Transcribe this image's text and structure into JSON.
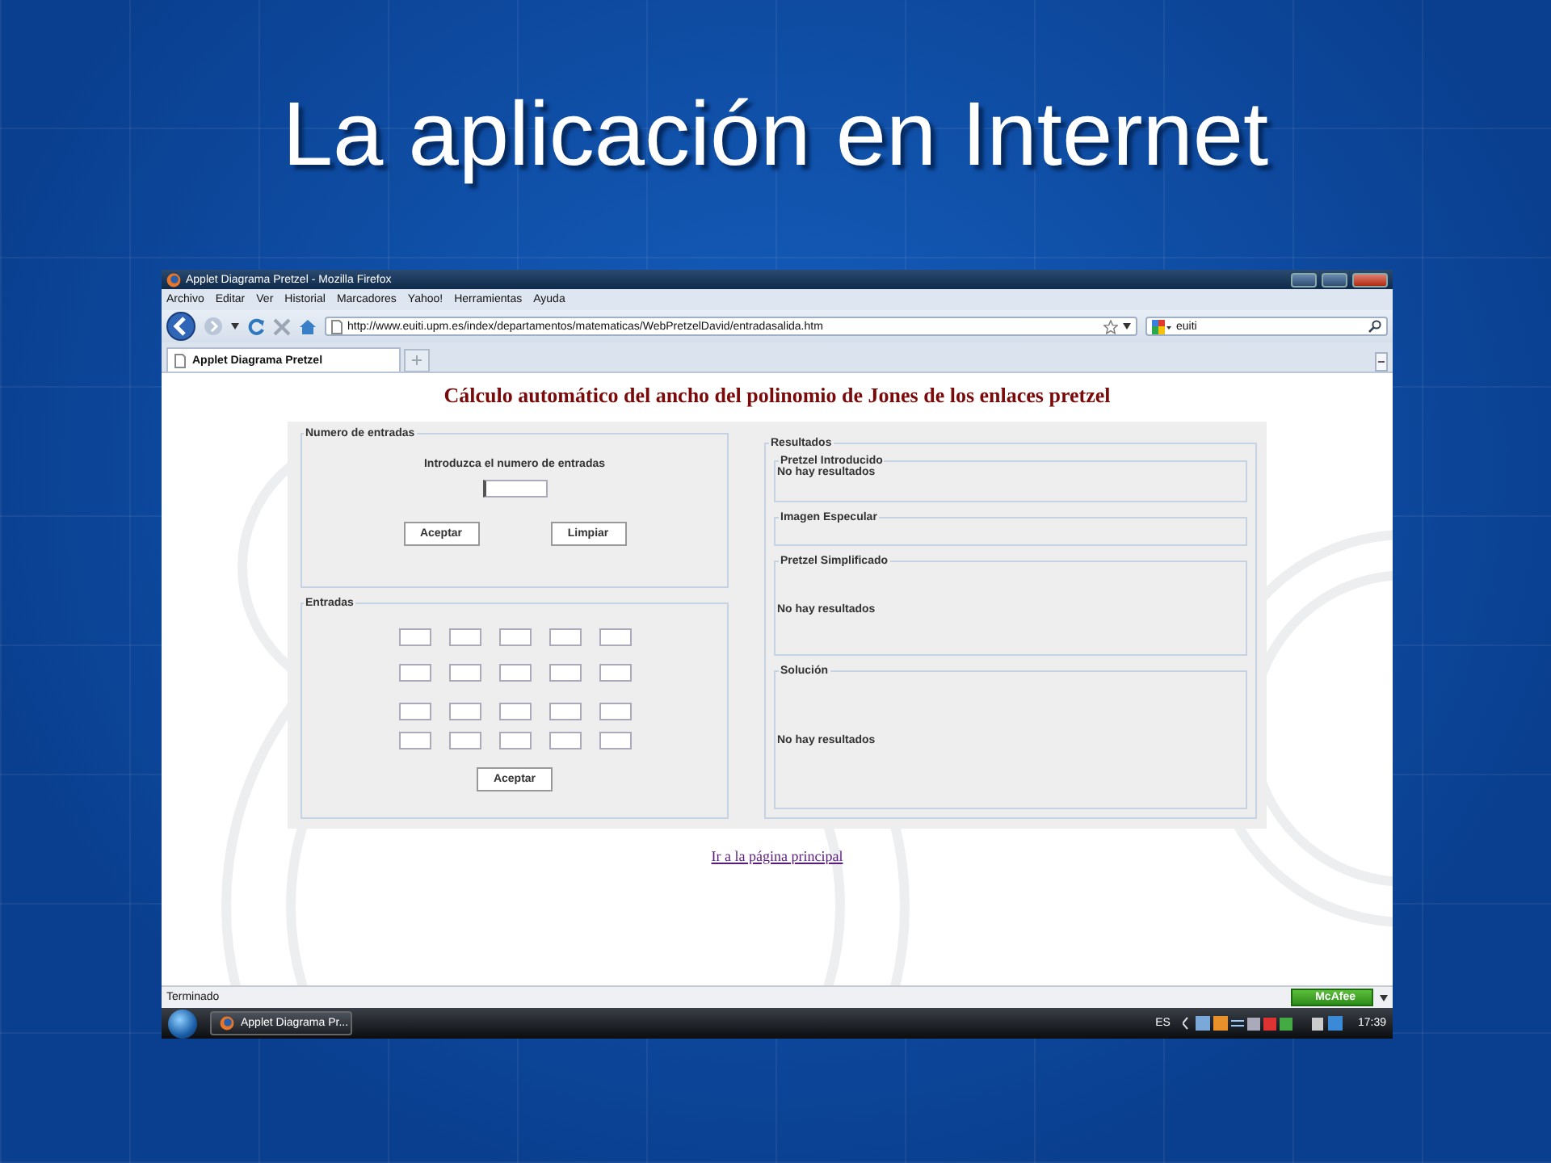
{
  "slide": {
    "title": "La aplicación en Internet"
  },
  "window": {
    "title": "Applet Diagrama Pretzel - Mozilla Firefox"
  },
  "menu": [
    "Archivo",
    "Editar",
    "Ver",
    "Historial",
    "Marcadores",
    "Yahoo!",
    "Herramientas",
    "Ayuda"
  ],
  "address_bar": {
    "value": "http://www.euiti.upm.es/index/departamentos/matematicas/WebPretzelDavid/entradasalida.htm"
  },
  "search": {
    "value": "euiti"
  },
  "tabs": [
    {
      "label": "Applet Diagrama Pretzel",
      "selected": true
    }
  ],
  "page": {
    "heading": "Cálculo automático del ancho del polinomio de Jones de los enlaces pretzel",
    "input_panel": {
      "legend": "Numero de entradas",
      "prompt": "Introduzca el numero de entradas",
      "buttons": [
        "Aceptar",
        "Limpiar"
      ]
    },
    "entries_panel": {
      "legend": "Entradas",
      "buttons": [
        "Aceptar"
      ]
    },
    "results": {
      "legend": "Resultados",
      "sections": [
        {
          "legend": "Pretzel Introducido",
          "text": "No hay resultados"
        },
        {
          "legend": "Imagen Especular"
        },
        {
          "legend": "Pretzel Simplificado",
          "text": "No hay resultados"
        },
        {
          "legend": "Solución",
          "text": "No hay resultados"
        }
      ]
    },
    "link": "Ir a la página principal"
  },
  "status_bar": {
    "text": "Terminado",
    "addon": "McAfee"
  },
  "taskbar": {
    "items": [
      "Applet Diagrama Pr..."
    ],
    "language": "ES",
    "time": "17:39"
  }
}
